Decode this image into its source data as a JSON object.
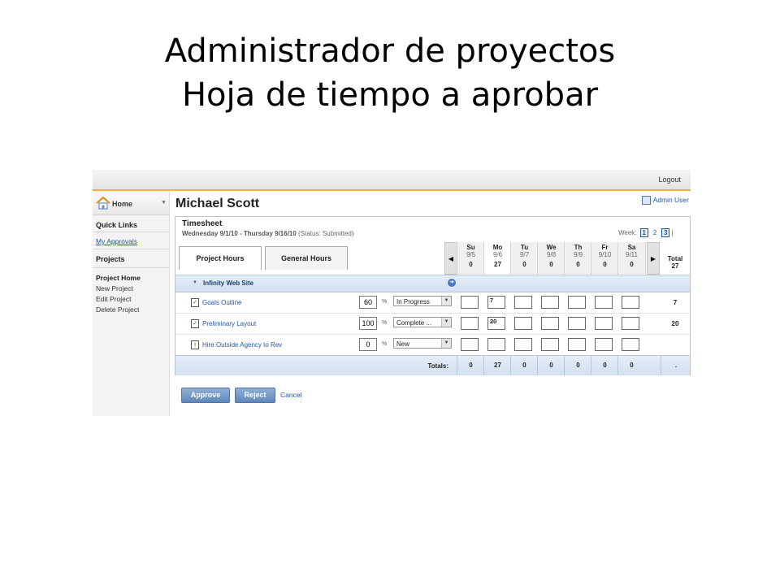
{
  "slide": {
    "title_line1": "Administrador de proyectos",
    "title_line2": "Hoja de tiempo a aprobar"
  },
  "topbar": {
    "logout": "Logout"
  },
  "sidebar": {
    "home": "Home",
    "quick_links": "Quick Links",
    "my_approvals": "My Approvals",
    "projects": "Projects",
    "project_home": "Project Home",
    "new_project": "New Project",
    "edit_project": "Edit Project",
    "delete_project": "Delete Project"
  },
  "header": {
    "user_name": "Michael Scott",
    "admin_user": "Admin User"
  },
  "timesheet": {
    "title": "Timesheet",
    "range": "Wednesday 9/1/10 - Thursday 9/16/10",
    "status": "(Status: Submitted)",
    "week_label": "Week:",
    "weeks": [
      "1",
      "2",
      "3"
    ],
    "week_separator": "|",
    "tabs": [
      "Project Hours",
      "General Hours"
    ],
    "days": [
      {
        "name": "Su",
        "date": "9/5",
        "total": "0"
      },
      {
        "name": "Mo",
        "date": "9/6",
        "total": "27"
      },
      {
        "name": "Tu",
        "date": "9/7",
        "total": "0"
      },
      {
        "name": "We",
        "date": "9/8",
        "total": "0"
      },
      {
        "name": "Th",
        "date": "9/9",
        "total": "0"
      },
      {
        "name": "Fr",
        "date": "9/10",
        "total": "0"
      },
      {
        "name": "Sa",
        "date": "9/11",
        "total": "0"
      }
    ],
    "total_label": "Total",
    "grand_total": "27",
    "project": "Infinity Web Site",
    "tasks": [
      {
        "name": "Goals Outline",
        "percent": "60",
        "status": "In Progress",
        "hours": [
          "",
          "7",
          "",
          "",
          "",
          "",
          ""
        ],
        "total": "7"
      },
      {
        "name": "Preliminary Layout",
        "percent": "100",
        "status": "Complete ...",
        "hours": [
          "",
          "20",
          "",
          "",
          "",
          "",
          ""
        ],
        "total": "20"
      },
      {
        "name": "Hire Outside Agency to Rev",
        "percent": "0",
        "status": "New",
        "hours": [
          "",
          "",
          "",
          "",
          "",
          "",
          ""
        ],
        "total": ""
      }
    ],
    "percent_symbol": "%",
    "totals_label": "Totals:",
    "column_totals": [
      "0",
      "27",
      "0",
      "0",
      "0",
      "0",
      "0"
    ],
    "grand_total_bottom": "."
  },
  "actions": {
    "approve": "Approve",
    "reject": "Reject",
    "cancel": "Cancel"
  },
  "colors": {
    "accent": "#f0b030",
    "link": "#2255aa",
    "button": "#5f87bb",
    "row_band": "#d2e0f0"
  }
}
